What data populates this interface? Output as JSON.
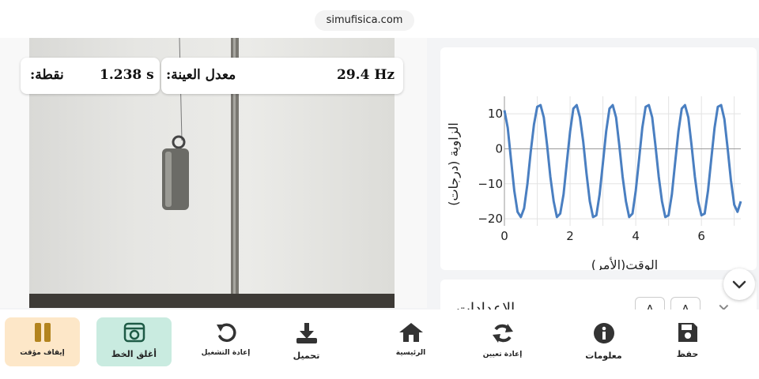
{
  "browser": {
    "url": "simufisica.com"
  },
  "video": {
    "stats": {
      "point_label": ":نقطة",
      "point_value": "1.238 s",
      "rate_label": ":معدل العينة",
      "rate_value": "29.4 Hz"
    }
  },
  "chart_data": {
    "type": "line",
    "xlabel": "الوقت(الأمر)",
    "ylabel": "الزاوية (درجات)",
    "xlim": [
      0,
      7.2
    ],
    "ylim": [
      -22,
      15
    ],
    "x_ticks": [
      0,
      2,
      4,
      6
    ],
    "y_ticks": [
      10,
      0,
      -10,
      -20
    ],
    "grid": true,
    "series": [
      {
        "color": "#4a7fc1",
        "x": [
          0.0,
          0.1,
          0.2,
          0.3,
          0.4,
          0.5,
          0.6,
          0.7,
          0.8,
          0.9,
          1.0,
          1.1,
          1.2,
          1.3,
          1.4,
          1.5,
          1.6,
          1.7,
          1.8,
          1.9,
          2.0,
          2.1,
          2.2,
          2.3,
          2.4,
          2.5,
          2.6,
          2.7,
          2.8,
          2.9,
          3.0,
          3.1,
          3.2,
          3.3,
          3.4,
          3.5,
          3.6,
          3.7,
          3.8,
          3.9,
          4.0,
          4.1,
          4.2,
          4.3,
          4.4,
          4.5,
          4.6,
          4.7,
          4.8,
          4.9,
          5.0,
          5.1,
          5.2,
          5.3,
          5.4,
          5.5,
          5.6,
          5.7,
          5.8,
          5.9,
          6.0,
          6.1,
          6.2,
          6.3,
          6.4,
          6.5,
          6.6,
          6.7,
          6.8,
          6.9,
          7.0,
          7.1,
          7.2
        ],
        "y": [
          11,
          6,
          -3,
          -12,
          -18,
          -19.5,
          -17,
          -10,
          -1,
          7,
          12,
          12.5,
          9,
          1,
          -8,
          -15,
          -19.5,
          -18.5,
          -13,
          -4,
          5,
          11.5,
          12.5,
          9,
          2,
          -7,
          -15,
          -19.5,
          -19,
          -13,
          -4,
          5,
          11.5,
          12.5,
          9,
          1,
          -8,
          -15,
          -19.5,
          -18.5,
          -12,
          -3,
          6,
          12,
          12.5,
          9,
          1,
          -8,
          -15,
          -19.5,
          -19,
          -13,
          -4,
          5,
          11.5,
          12.5,
          9,
          1,
          -8,
          -15,
          -19,
          -18.5,
          -12,
          -3,
          6,
          12,
          12.5,
          8.5,
          0,
          -9,
          -16,
          -18,
          -15
        ]
      }
    ]
  },
  "settings": {
    "title": "الإعدادات",
    "btn_a": "A",
    "btn_b": "A"
  },
  "toolbar": {
    "pause": "إيقاف مؤقت",
    "close_line": "أغلق الخط",
    "restart": "إعادة التشغيل",
    "download": "تحميل",
    "home": "الرئيسية",
    "reset": "إعادة تعيين",
    "info": "معلومات",
    "save": "حفظ"
  }
}
